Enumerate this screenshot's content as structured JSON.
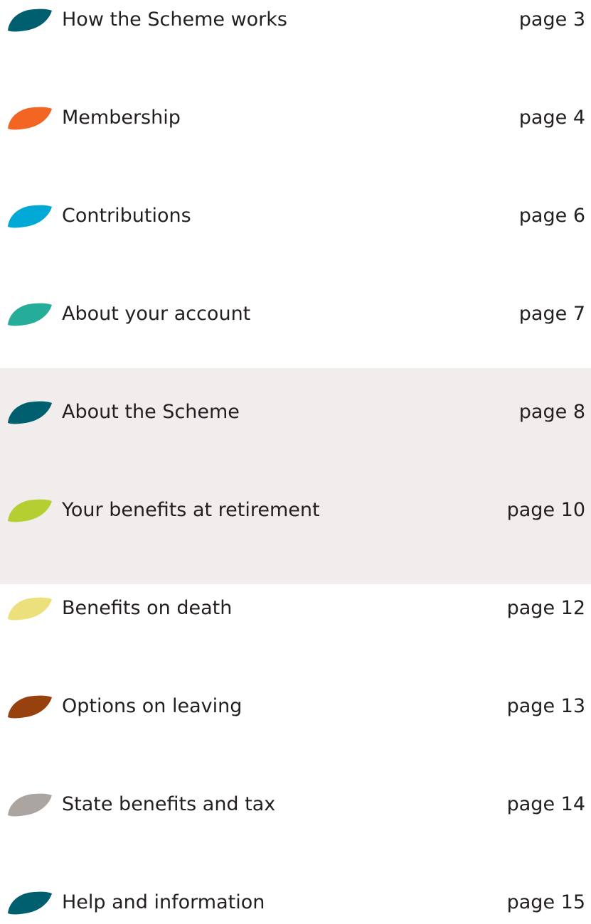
{
  "toc": {
    "items": [
      {
        "title": "How the Scheme works",
        "page": "page 3",
        "color": "#005f6e",
        "icon": "leaf-icon"
      },
      {
        "title": "Membership",
        "page": "page 4",
        "color": "#f26522",
        "icon": "leaf-icon"
      },
      {
        "title": "Contributions",
        "page": "page 6",
        "color": "#00a8d6",
        "icon": "leaf-icon"
      },
      {
        "title": "About your account",
        "page": "page 7",
        "color": "#26ad9a",
        "icon": "leaf-icon"
      },
      {
        "title": "About the Scheme",
        "page": "page 8",
        "color": "#005f6e",
        "icon": "leaf-icon"
      },
      {
        "title": "Your benefits at retirement",
        "page": "page 10",
        "color": "#b5cf33",
        "icon": "leaf-icon"
      },
      {
        "title": "Benefits on death",
        "page": "page 12",
        "color": "#ebe07b",
        "icon": "leaf-icon"
      },
      {
        "title": "Options on leaving",
        "page": "page 13",
        "color": "#97410f",
        "icon": "leaf-icon"
      },
      {
        "title": "State benefits and tax",
        "page": "page 14",
        "color": "#aba5a2",
        "icon": "leaf-icon"
      },
      {
        "title": "Help and information",
        "page": "page 15",
        "color": "#005f6e",
        "icon": "leaf-icon"
      }
    ],
    "highlight_color": "#f1eded"
  }
}
